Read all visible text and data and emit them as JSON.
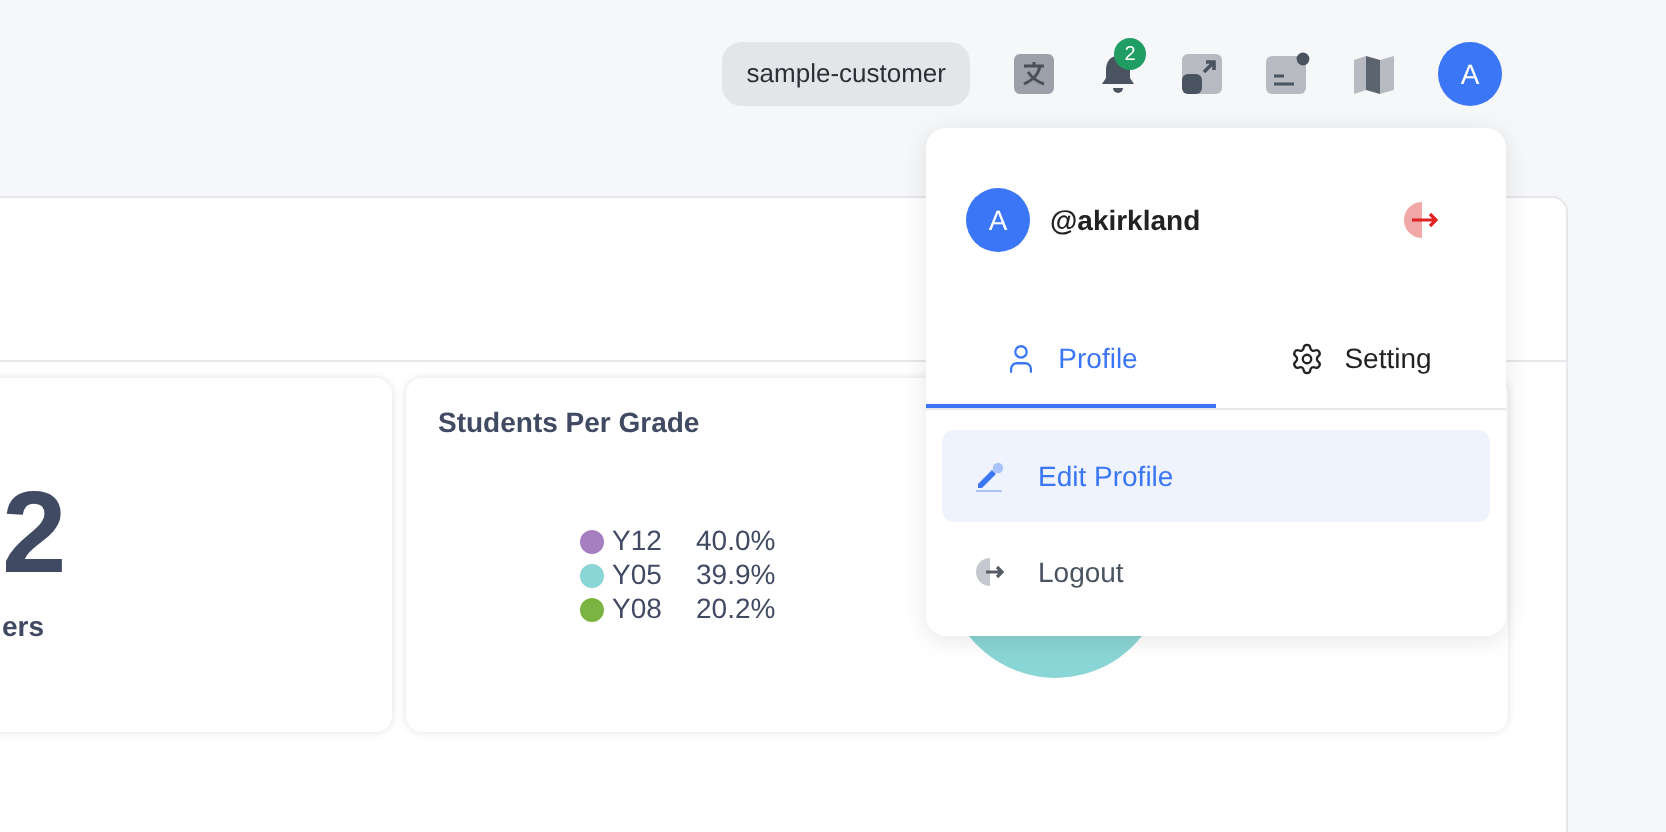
{
  "topbar": {
    "customer": "sample-customer",
    "notifications": {
      "count": "2"
    },
    "avatar": "A"
  },
  "menu": {
    "avatar": "A",
    "username": "@akirkland",
    "tabs": [
      {
        "label": "Profile",
        "selected": true,
        "kind": "profile"
      },
      {
        "label": "Setting",
        "selected": false,
        "kind": "setting"
      }
    ],
    "items": [
      {
        "label": "Edit Profile",
        "selected": true,
        "kind": "edit"
      },
      {
        "label": "Logout",
        "selected": false,
        "kind": "logout"
      }
    ]
  },
  "stat_card": {
    "value": "2",
    "label": "ers"
  },
  "grade_card": {
    "title": "Students Per Grade",
    "legend": [
      {
        "label": "Y12",
        "percent": "40.0%",
        "color": "#a67fc1"
      },
      {
        "label": "Y05",
        "percent": "39.9%",
        "color": "#8ad5d5"
      },
      {
        "label": "Y08",
        "percent": "20.2%",
        "color": "#7cb442"
      }
    ]
  }
}
